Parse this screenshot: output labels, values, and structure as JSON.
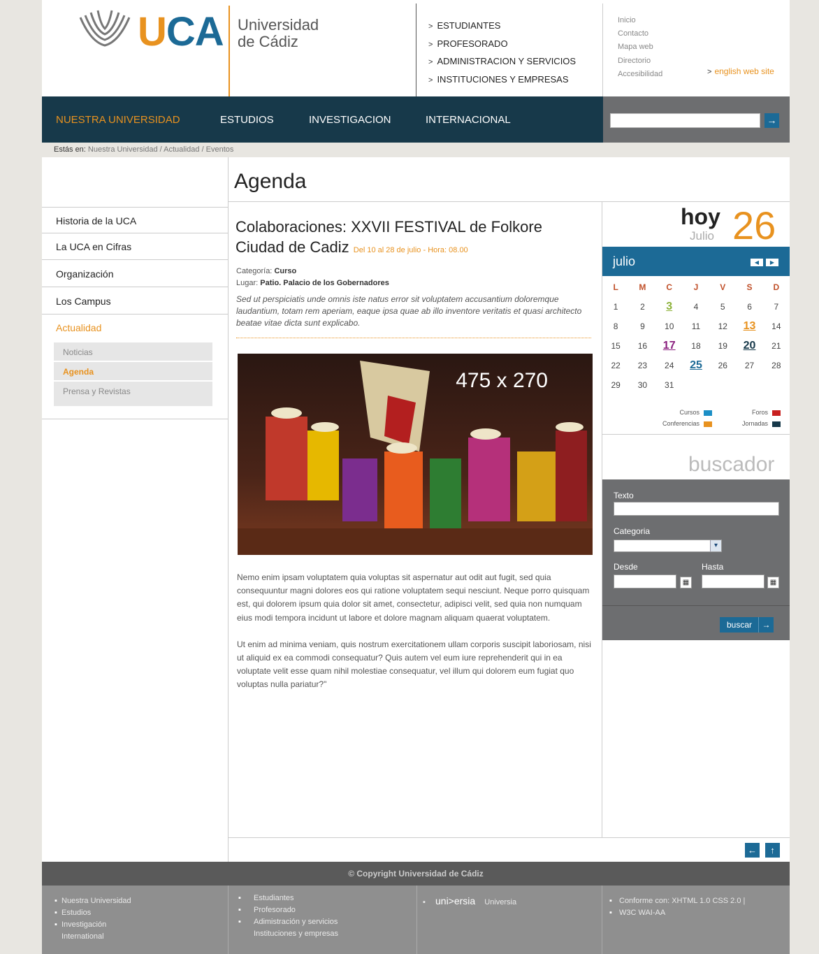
{
  "header": {
    "logo_mark": "UCA",
    "logo_uca_u": "U",
    "logo_uca_ca": "CA",
    "logo_name_1": "Universidad",
    "logo_name_2": "de Cádiz",
    "audience_links": [
      "ESTUDIANTES",
      "PROFESORADO",
      "ADMINISTRACION Y SERVICIOS",
      "INSTITUCIONES Y EMPRESAS"
    ],
    "utility_links": [
      "Inicio",
      "Contacto",
      "Mapa web",
      "Directorio",
      "Accesibilidad"
    ],
    "english_link": "english web site",
    "chevron": ">"
  },
  "nav": {
    "items": [
      "NUESTRA  UNIVERSIDAD",
      "ESTUDIOS",
      "INVESTIGACION",
      "INTERNACIONAL"
    ],
    "search_go": "→"
  },
  "breadcrumb": {
    "label": "Estás en:",
    "path": "Nuestra Universidad  /  Actualidad  /  Eventos"
  },
  "left_menu": {
    "items": [
      "Historia de la UCA",
      "La UCA en Cifras",
      "Organización",
      "Los Campus",
      "Actualidad"
    ],
    "sub_items": [
      "Noticias",
      "Agenda",
      "Prensa y Revistas"
    ]
  },
  "main": {
    "heading": "Agenda",
    "event_title": "Colaboraciones: XXVII FESTIVAL de Folkore Ciudad de Cadiz",
    "event_date": "Del 10 al 28 de julio  - Hora:  08.00",
    "category_label": "Categoría:",
    "category_value": "Curso",
    "place_label": "Lugar:",
    "place_value": "Patio. Palacio de los Gobernadores",
    "summary": "Sed ut perspiciatis unde omnis iste natus error sit voluptatem accusantium doloremque laudantium, totam rem aperiam, eaque ipsa quae ab illo inventore veritatis et quasi architecto beatae vitae dicta sunt explicabo.",
    "image_label": "475 x 270",
    "body_p1": "Nemo enim ipsam voluptatem quia voluptas sit aspernatur aut odit aut fugit, sed quia consequuntur magni dolores eos qui ratione voluptatem sequi nesciunt. Neque porro quisquam est, qui dolorem ipsum quia dolor sit amet, consectetur, adipisci velit, sed quia non numquam eius modi tempora incidunt ut labore et dolore magnam aliquam quaerat voluptatem.",
    "body_p2": "Ut enim ad minima veniam, quis nostrum exercitationem ullam corporis suscipit laboriosam, nisi ut aliquid ex ea commodi consequatur? Quis autem vel eum iure reprehenderit qui in ea voluptate velit esse quam nihil molestiae consequatur, vel illum qui dolorem eum fugiat quo voluptas nulla pariatur?\"",
    "back_icon": "←",
    "top_icon": "↑"
  },
  "today": {
    "label": "hoy",
    "month": "Julio",
    "day": "26"
  },
  "calendar": {
    "month": "julio",
    "weekdays": [
      "L",
      "M",
      "C",
      "J",
      "V",
      "S",
      "D"
    ],
    "weeks": [
      [
        "1",
        "2",
        "3",
        "4",
        "5",
        "6",
        "7"
      ],
      [
        "8",
        "9",
        "10",
        "11",
        "12",
        "13",
        "14"
      ],
      [
        "15",
        "16",
        "17",
        "18",
        "19",
        "20",
        "21"
      ],
      [
        "22",
        "23",
        "24",
        "25",
        "26",
        "27",
        "28"
      ],
      [
        "29",
        "30",
        "31",
        "",
        "",
        "",
        ""
      ]
    ],
    "highlights": {
      "3": "#8db23a",
      "13": "#e8921f",
      "17": "#8a1f7e",
      "20": "#17394a",
      "25": "#1c6a96"
    },
    "prev_icon": "◀",
    "next_icon": "▶"
  },
  "legend": {
    "items": [
      {
        "label": "Cursos",
        "color": "#1c8fc6"
      },
      {
        "label": "Foros",
        "color": "#c8201f"
      },
      {
        "label": "Conferencias",
        "color": "#e8921f"
      },
      {
        "label": "Jornadas",
        "color": "#17394a"
      }
    ]
  },
  "buscador": {
    "title": "buscador",
    "text_label": "Texto",
    "category_label": "Categoria",
    "from_label": "Desde",
    "to_label": "Hasta",
    "submit": "buscar",
    "submit_icon": "→",
    "select_icon": "▾",
    "cal_icon": "▦"
  },
  "footer": {
    "copyright": "© Copyright Universidad de Cádiz",
    "col1": [
      "Nuestra Universidad",
      "Estudios",
      "Investigación",
      "International"
    ],
    "col2": [
      "Estudiantes",
      "Profesorado",
      "Adimistración y servicios",
      "Instituciones y empresas"
    ],
    "col3_logo": "uni>ersia",
    "col3_text": "Universia",
    "col4": [
      "Conforme con: XHTML 1.0  CSS 2.0 |",
      "W3C  WAI-AA"
    ],
    "bullet": "▪"
  }
}
